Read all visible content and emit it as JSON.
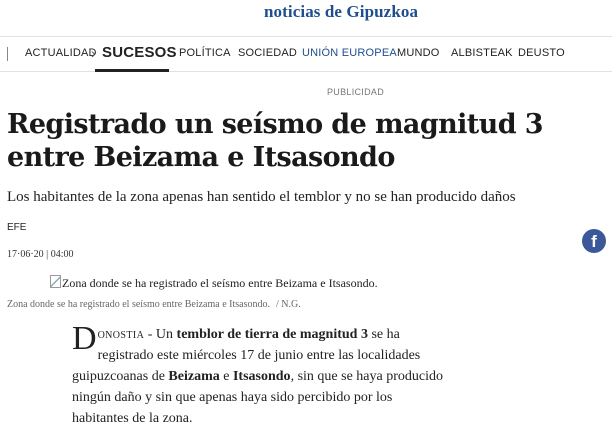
{
  "header": {
    "logo_text": "noticias de Gipuzkoa"
  },
  "nav": {
    "items": [
      {
        "label": "ACTUALIDAD"
      },
      {
        "label": "SUCESOS"
      },
      {
        "label": "POLÍTICA"
      },
      {
        "label": "SOCIEDAD"
      },
      {
        "label": "UNIÓN EUROPEA"
      },
      {
        "label": "MUNDO"
      },
      {
        "label": "ALBISTEAK"
      },
      {
        "label": "DEUSTO"
      }
    ],
    "active": "SUCESOS"
  },
  "ad": {
    "label": "PUBLICIDAD"
  },
  "article": {
    "headline": "Registrado un seísmo de magnitud 3 entre Beizama e Itsasondo",
    "subtitle": "Los habitantes de la zona apenas han sentido el temblor y no se han producido daños",
    "author": "EFE",
    "date": "17·06·20",
    "time": "04:00",
    "image_alt": "Zona donde se ha registrado el seísmo entre Beizama e Itsasondo.",
    "caption": "Zona donde se ha registrado el seísmo entre Beizama e Itsasondo.",
    "caption_credit": "/ N.G.",
    "body": {
      "dropcap": "D",
      "city": "onostia",
      "t1": " - Un ",
      "b1": "temblor de tierra de magnitud 3",
      "t2": " se ha registrado este miércoles 17 de junio entre las localidades guipuzcoanas de ",
      "b2": "Beizama",
      "t3": " e ",
      "b3": "Itsasondo",
      "t4": ", sin que se haya producido ningún daño y sin que apenas haya sido percibido por los habitantes de la zona."
    }
  },
  "share": {
    "facebook_icon": "facebook-icon",
    "facebook_glyph": "f",
    "facebook_color": "#3b5998"
  },
  "colors": {
    "brand": "#1f4e8c",
    "text": "#222222",
    "muted": "#777777"
  }
}
